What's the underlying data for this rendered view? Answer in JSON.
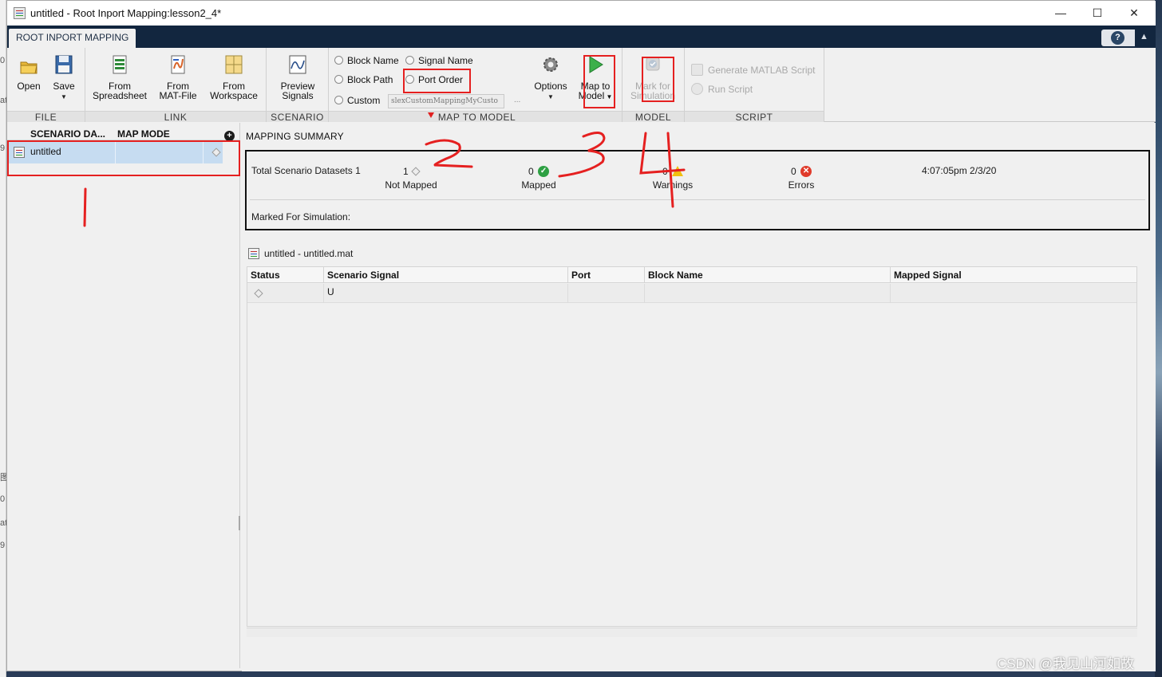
{
  "window": {
    "title": "untitled - Root Inport Mapping:lesson2_4*",
    "minimize": "—",
    "maximize": "☐",
    "close": "✕"
  },
  "toolstrip": {
    "tab": "ROOT INPORT MAPPING",
    "help": "?",
    "collapse": "▲"
  },
  "ribbon": {
    "file": {
      "label": "FILE",
      "open": "Open",
      "save": "Save"
    },
    "link": {
      "label": "LINK",
      "from_spreadsheet": [
        "From",
        "Spreadsheet"
      ],
      "from_mat": [
        "From",
        "MAT-File"
      ],
      "from_workspace": [
        "From",
        "Workspace"
      ]
    },
    "scenario": {
      "label": "SCENARIO",
      "preview": [
        "Preview",
        "Signals"
      ]
    },
    "map_to_model": {
      "label": "MAP TO MODEL",
      "block_name": "Block Name",
      "signal_name": "Signal Name",
      "block_path": "Block Path",
      "port_order": "Port Order",
      "custom": "Custom",
      "custom_value": "slexCustomMappingMyCusto",
      "custom_more": "...",
      "options": "Options",
      "map_to_model": [
        "Map to",
        "Model"
      ]
    },
    "model": {
      "label": "MODEL",
      "mark": [
        "Mark for",
        "Simulation"
      ]
    },
    "script": {
      "label": "SCRIPT",
      "generate": "Generate MATLAB Script",
      "run": "Run Script"
    }
  },
  "left_panel": {
    "col_scenario": "SCENARIO DA...",
    "col_map_mode": "MAP MODE",
    "add": "+",
    "datasets": [
      {
        "name": "untitled",
        "map_mode": "",
        "status_icon": "not-mapped-diamond"
      }
    ]
  },
  "summary": {
    "title": "MAPPING SUMMARY",
    "total_label": "Total Scenario Datasets 1",
    "not_mapped": {
      "count": "1",
      "label": "Not Mapped"
    },
    "mapped": {
      "count": "0",
      "label": "Mapped"
    },
    "warnings": {
      "count": "0",
      "label": "Warnings"
    },
    "errors": {
      "count": "0",
      "label": "Errors"
    },
    "timestamp": "4:07:05pm 2/3/20",
    "marked_label": "Marked For Simulation:"
  },
  "file_label": "untitled - untitled.mat",
  "signal_table": {
    "columns": [
      "Status",
      "Scenario Signal",
      "Port",
      "Block Name",
      "Mapped Signal"
    ],
    "rows": [
      {
        "status": "",
        "signal": "U",
        "port": "",
        "block": "",
        "mapped": ""
      }
    ]
  },
  "annotations": [
    "1",
    "2",
    "3",
    "4"
  ],
  "watermark": "CSDN @我见山河如故",
  "colors": {
    "tab_bar": "#12263f",
    "selection": "#c6dcf1",
    "annotation_red": "#e52020",
    "ok_green": "#2ea043",
    "warn_yellow": "#f0c010",
    "error_red": "#e03a2a"
  }
}
